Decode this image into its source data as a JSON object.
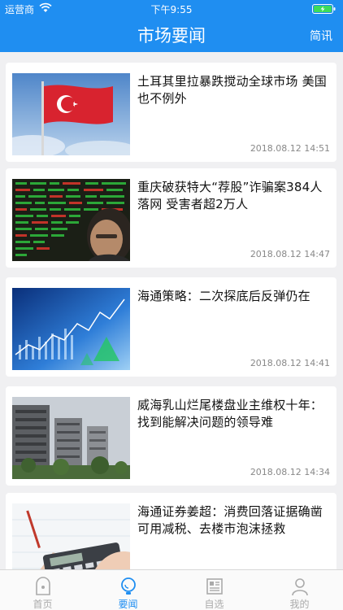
{
  "status_bar": {
    "carrier": "运营商",
    "time": "下午9:55"
  },
  "nav": {
    "title": "市场要闻",
    "right_label": "简讯"
  },
  "news": [
    {
      "title": "土耳其里拉暴跌搅动全球市场 美国也不例外",
      "time": "2018.08.12 14:51",
      "image": "turkey-flag"
    },
    {
      "title": "重庆破获特大“荐股”诈骗案384人落网 受害者超2万人",
      "time": "2018.08.12 14:47",
      "image": "stock-board-man"
    },
    {
      "title": "海通策略：二次探底后反弹仍在",
      "time": "2018.08.12 14:41",
      "image": "blue-chart"
    },
    {
      "title": "威海乳山烂尾楼盘业主维权十年：找到能解决问题的领导难",
      "time": "2018.08.12 14:34",
      "image": "unfinished-buildings"
    },
    {
      "title": "海通证券姜超：消费回落证据确凿 可用减税、去楼市泡沫拯救",
      "time": "",
      "image": "calculator-hand"
    }
  ],
  "tabs": [
    {
      "label": "首页",
      "icon": "home-icon",
      "active": false
    },
    {
      "label": "要闻",
      "icon": "news-icon",
      "active": true
    },
    {
      "label": "自选",
      "icon": "watchlist-icon",
      "active": false
    },
    {
      "label": "我的",
      "icon": "profile-icon",
      "active": false
    }
  ],
  "colors": {
    "accent": "#1f8ef1",
    "background": "#f0f0f2",
    "inactive_tab": "#aaaaaa"
  }
}
